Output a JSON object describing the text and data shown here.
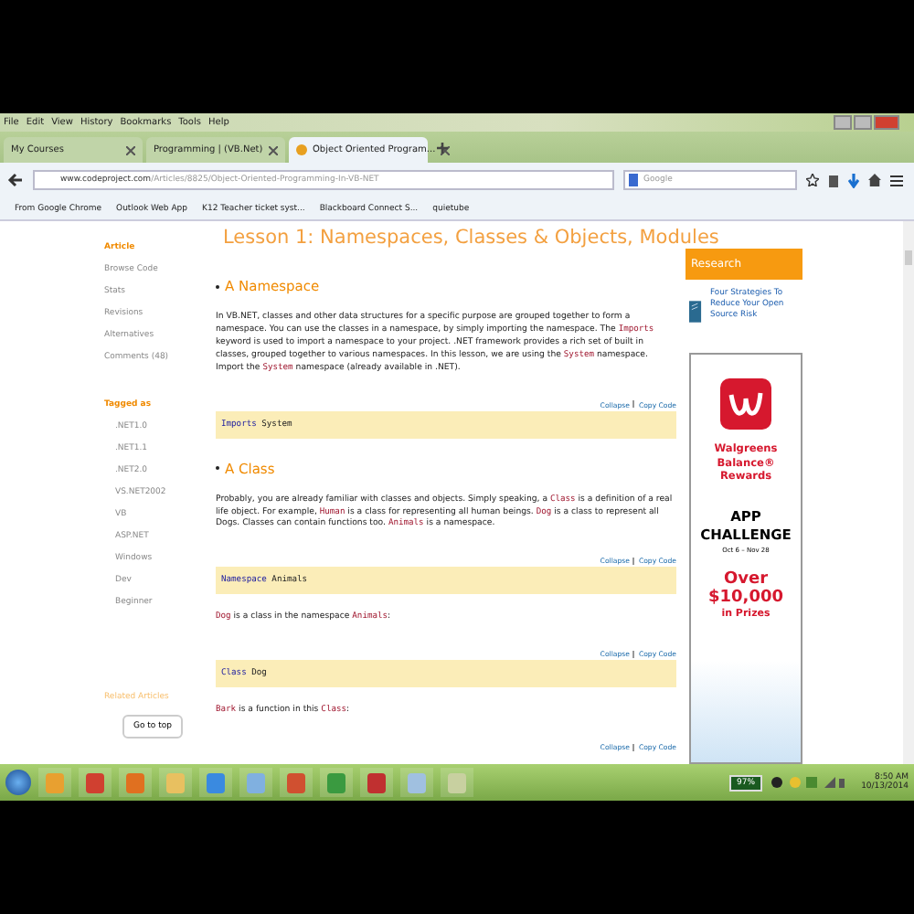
{
  "menu": [
    "File",
    "Edit",
    "View",
    "History",
    "Bookmarks",
    "Tools",
    "Help"
  ],
  "tabs": [
    {
      "label": "My Courses",
      "selected": false
    },
    {
      "label": "Programming | (VB.Net)",
      "selected": false
    },
    {
      "label": "Object Oriented Program...",
      "selected": true
    }
  ],
  "address": {
    "host": "www.codeproject.com",
    "path": "/Articles/8825/Object-Oriented-Programming-In-VB-NET"
  },
  "search": {
    "placeholder": "Google"
  },
  "bookmarks": [
    "From Google Chrome",
    "Outlook Web App",
    "K12 Teacher ticket syst...",
    "Blackboard Connect S...",
    "quietube"
  ],
  "nav": {
    "items": [
      {
        "label": "Article",
        "selected": true
      },
      {
        "label": "Browse Code",
        "selected": false
      },
      {
        "label": "Stats",
        "selected": false
      },
      {
        "label": "Revisions",
        "selected": false
      },
      {
        "label": "Alternatives",
        "selected": false
      },
      {
        "label": "Comments (48)",
        "selected": false
      }
    ],
    "tagged_heading": "Tagged as",
    "tags": [
      ".NET1.0",
      ".NET1.1",
      ".NET2.0",
      "VS.NET2002",
      "VB",
      "ASP.NET",
      "Windows",
      "Dev",
      "Beginner"
    ],
    "related": "Related Articles",
    "go_top": "Go to top"
  },
  "article": {
    "title": "Lesson 1: Namespaces, Classes & Objects, Modules",
    "blocks": [
      {
        "kind": "heading",
        "text": "A Namespace"
      },
      {
        "kind": "para",
        "segments": [
          {
            "text": "In VB.NET, classes and other data structures for a specific purpose are grouped together to form a namespace. You can use the classes in a namespace, by simply importing the namespace. The ",
            "code": false
          },
          {
            "text": "Imports",
            "code": true
          },
          {
            "text": " keyword is used to import a namespace to your project. .NET framework provides a rich set of built in classes, grouped together to various namespaces. In this lesson, we are using the ",
            "code": false
          },
          {
            "text": "System",
            "code": true
          },
          {
            "text": " namespace. Import the ",
            "code": false
          },
          {
            "text": "System",
            "code": true
          },
          {
            "text": " namespace (already available in .NET).",
            "code": false
          }
        ]
      },
      {
        "kind": "code",
        "collapse": "Collapse",
        "copy": "Copy Code",
        "keyword": "Imports",
        "rest": "System"
      },
      {
        "kind": "heading",
        "text": "A Class"
      },
      {
        "kind": "para",
        "segments": [
          {
            "text": "Probably, you are already familiar with classes and objects. Simply speaking, a ",
            "code": false
          },
          {
            "text": "Class",
            "code": true
          },
          {
            "text": " is a definition of a real life object. For example, ",
            "code": false
          },
          {
            "text": "Human",
            "code": true
          },
          {
            "text": " is a class for representing all human beings. ",
            "code": false
          },
          {
            "text": "Dog",
            "code": true
          },
          {
            "text": " is a class to represent all Dogs. Classes can contain functions too. ",
            "code": false
          },
          {
            "text": "Animals",
            "code": true
          },
          {
            "text": " is a namespace.",
            "code": false
          }
        ]
      },
      {
        "kind": "code",
        "collapse": "Collapse",
        "copy": "Copy Code",
        "keyword": "Namespace",
        "rest": "Animals"
      },
      {
        "kind": "para",
        "segments": [
          {
            "text": "Dog",
            "code": true
          },
          {
            "text": " is a class in the namespace ",
            "code": false
          },
          {
            "text": "Animals",
            "code": true
          },
          {
            "text": ":",
            "code": false
          }
        ]
      },
      {
        "kind": "code",
        "collapse": "Collapse",
        "copy": "Copy Code",
        "keyword": "Class",
        "rest": "Dog"
      },
      {
        "kind": "para",
        "segments": [
          {
            "text": "Bark",
            "code": true
          },
          {
            "text": " is a function in this ",
            "code": false
          },
          {
            "text": "Class",
            "code": true
          },
          {
            "text": ":",
            "code": false
          }
        ]
      },
      {
        "kind": "tools",
        "collapse": "Collapse",
        "copy": "Copy Code"
      }
    ]
  },
  "sidebar": {
    "heading": "Research",
    "link": "Four Strategies To Reduce Your Open Source Risk",
    "ad": {
      "brand": "Walgreens Balance® Rewards",
      "title": "APP CHALLENGE",
      "dates": "Oct 6 – Nov 28",
      "prize": "Over $10,000",
      "prize_sub": "in Prizes"
    }
  },
  "taskbar": {
    "battery": "97%",
    "time": "8:50 AM",
    "date": "10/13/2014"
  }
}
